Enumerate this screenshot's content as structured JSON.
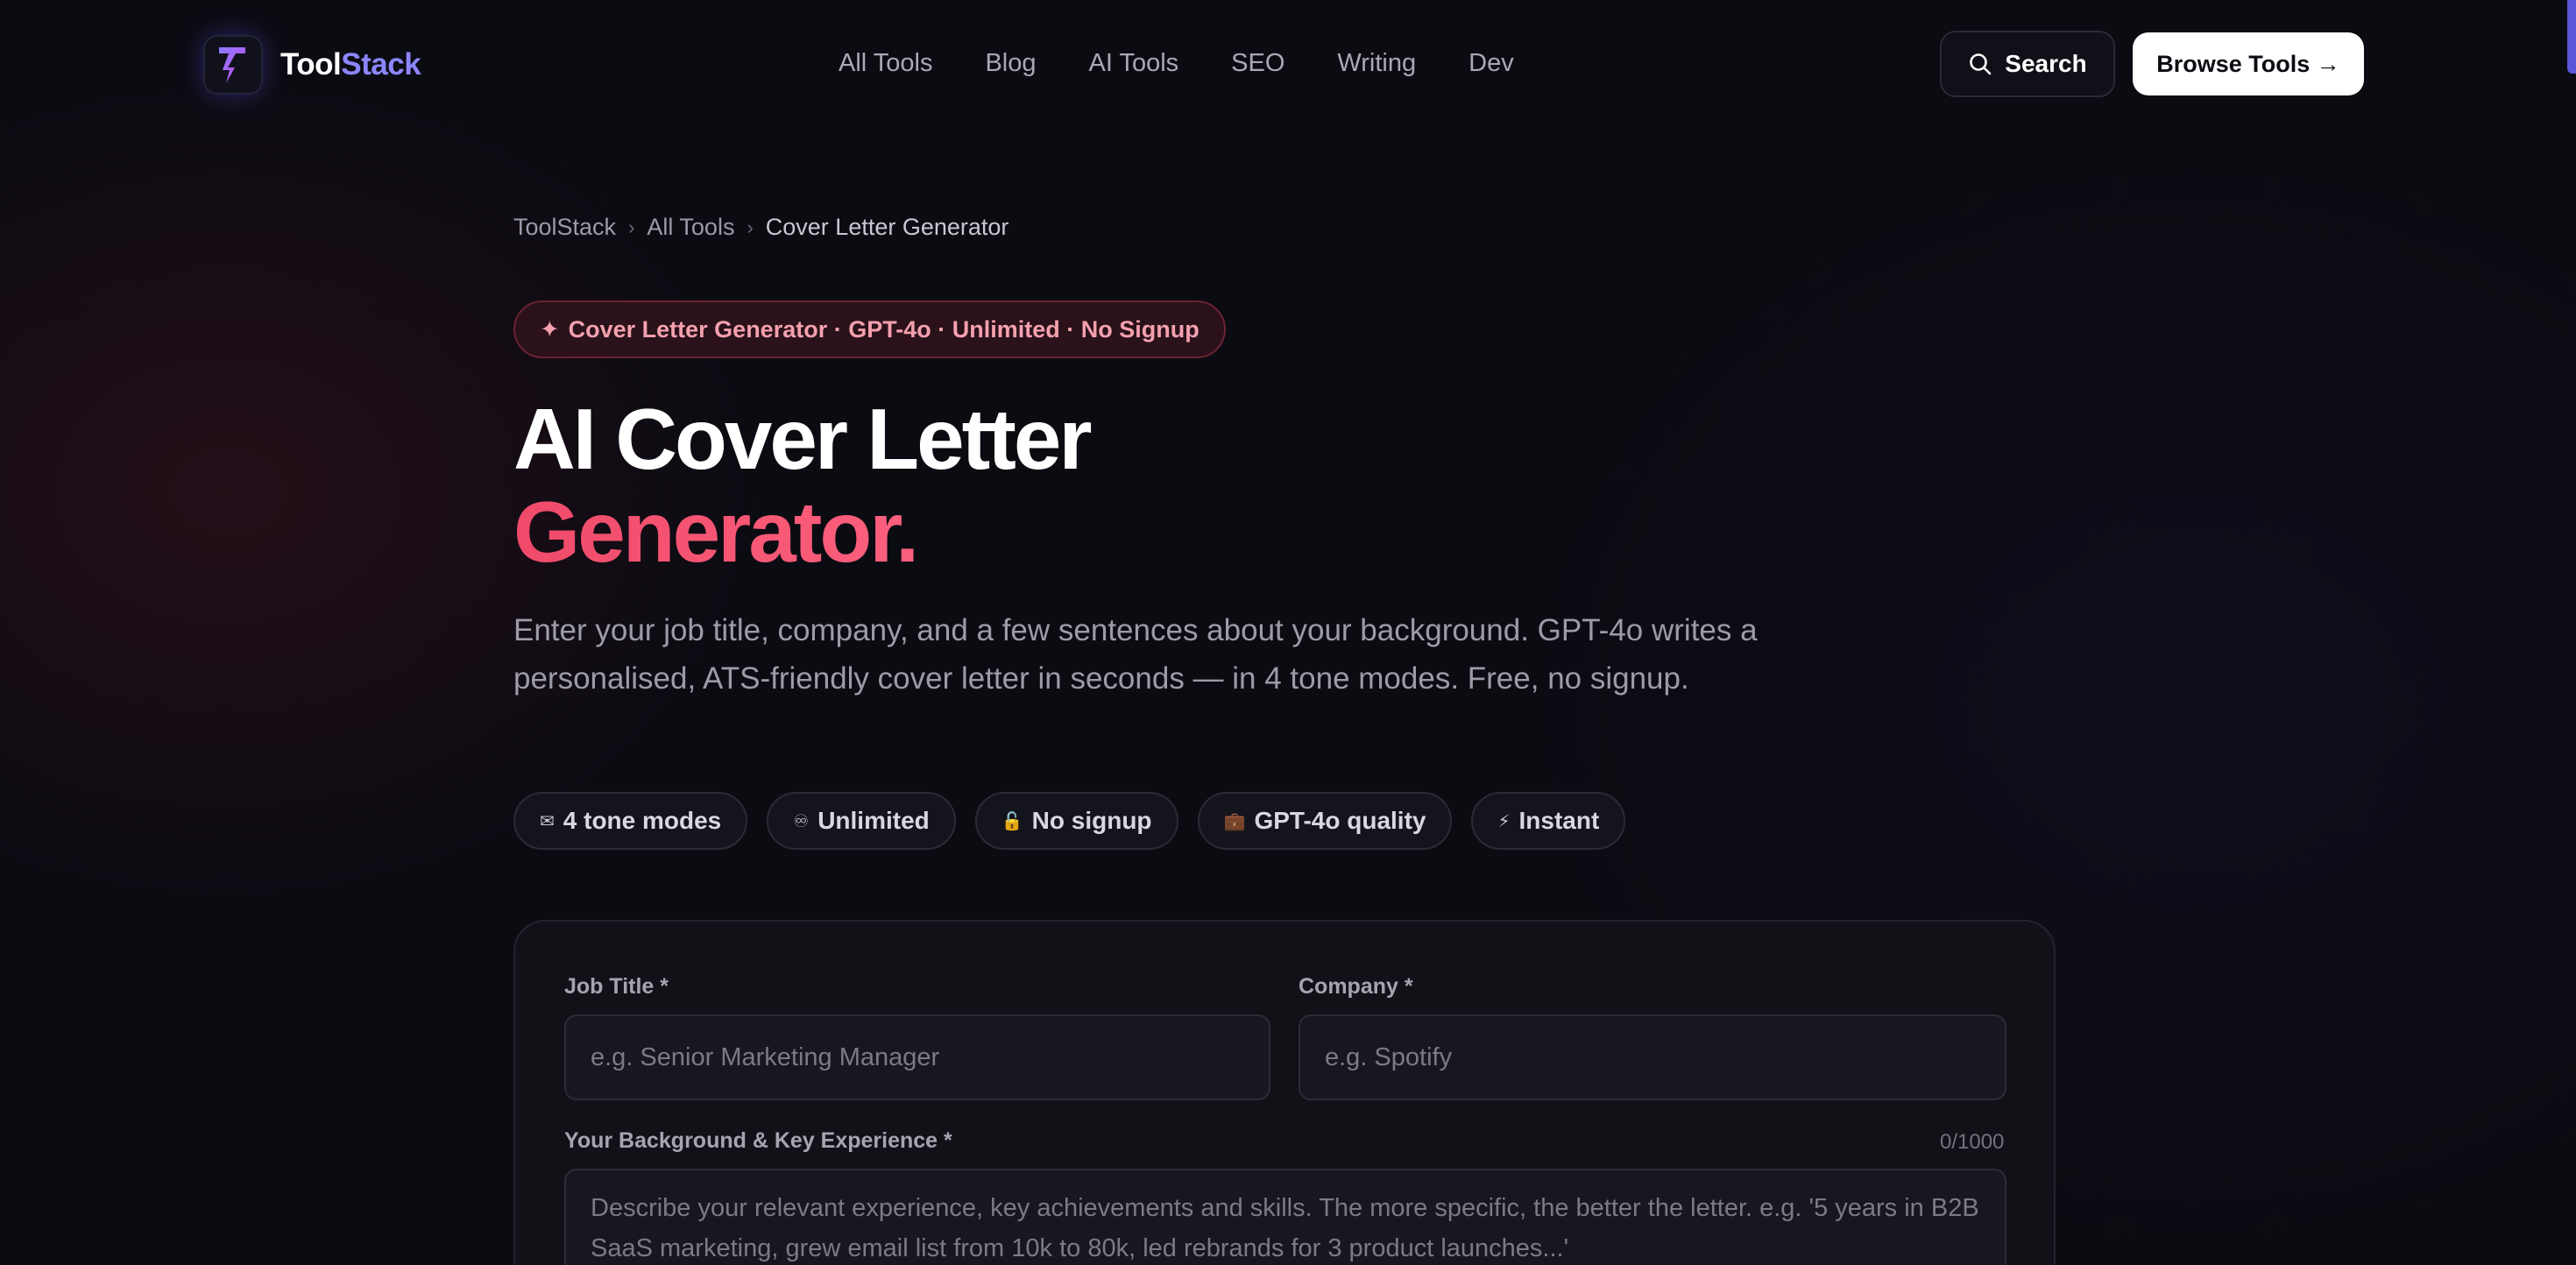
{
  "brand": {
    "name_part1": "Tool",
    "name_part2": "Stack",
    "logo_icon": "lightning-bolt-logo"
  },
  "nav": {
    "items": [
      "All Tools",
      "Blog",
      "AI Tools",
      "SEO",
      "Writing",
      "Dev"
    ]
  },
  "header": {
    "search_label": "Search",
    "search_icon": "search-icon",
    "browse_label": "Browse Tools →"
  },
  "breadcrumb": {
    "items": [
      "ToolStack",
      "All Tools",
      "Cover Letter Generator"
    ],
    "separator": "›"
  },
  "badge": {
    "icon": "✦",
    "text": "Cover Letter Generator · GPT-4o · Unlimited · No Signup"
  },
  "hero": {
    "title_line1": "AI Cover Letter",
    "title_line2": "Generator.",
    "subtitle": "Enter your job title, company, and a few sentences about your background. GPT-4o writes a personalised, ATS-friendly cover letter in seconds — in 4 tone modes. Free, no signup."
  },
  "chips": [
    {
      "icon": "✉",
      "label": "4 tone modes"
    },
    {
      "icon": "♾",
      "label": "Unlimited"
    },
    {
      "icon": "🔓",
      "label": "No signup"
    },
    {
      "icon": "💼",
      "label": "GPT-4o quality"
    },
    {
      "icon": "⚡",
      "label": "Instant"
    }
  ],
  "form": {
    "job_title_label": "Job Title *",
    "job_title_value": "",
    "job_title_placeholder": "e.g. Senior Marketing Manager",
    "company_label": "Company *",
    "company_value": "",
    "company_placeholder": "e.g. Spotify",
    "background_label": "Your Background & Key Experience *",
    "background_counter": "0/1000",
    "background_value": "",
    "background_placeholder": "Describe your relevant experience, key achievements and skills. The more specific, the better the letter. e.g. '5 years in B2B SaaS marketing, grew email list from 10k to 80k, led rebrands for 3 product launches...'"
  },
  "colors": {
    "background": "#0b0b12",
    "brand_accent": "#8b86ff",
    "title_accent": "#ff5a7a",
    "badge_text": "#f4a0ae"
  }
}
